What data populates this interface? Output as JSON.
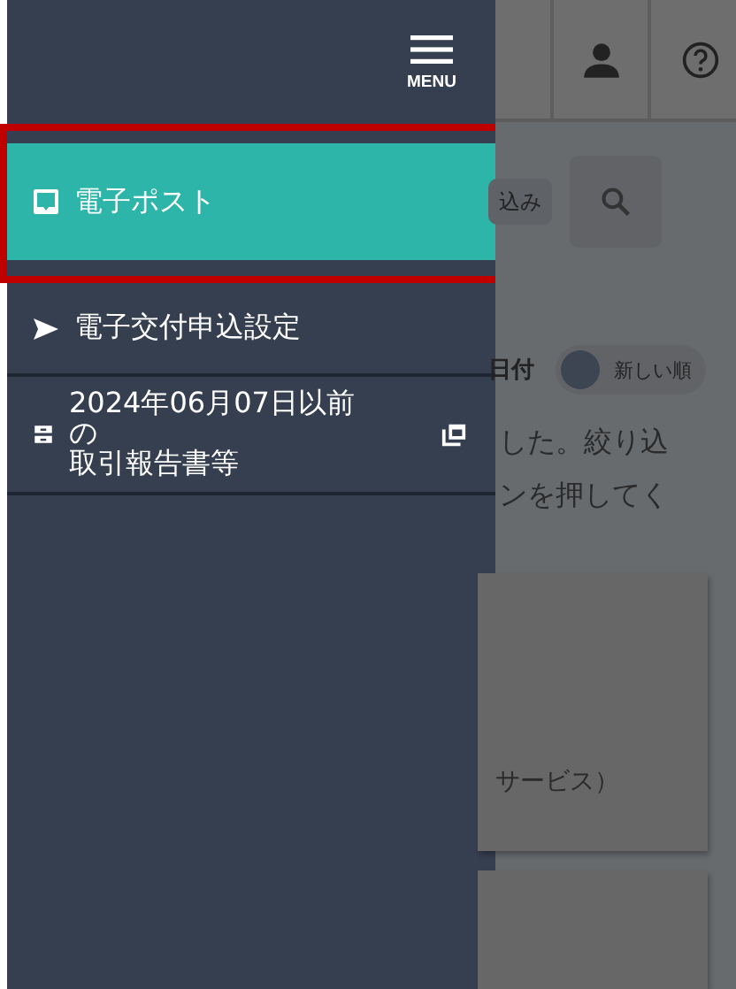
{
  "menu_button": {
    "label": "MENU"
  },
  "drawer_items": [
    {
      "label_lines": [
        "電子ポスト"
      ],
      "kind": "inbox",
      "selected": true,
      "highlighted": true,
      "external": false
    },
    {
      "label_lines": [
        "電子交付申込設定"
      ],
      "kind": "send",
      "selected": false,
      "highlighted": false,
      "external": false
    },
    {
      "label_lines": [
        "2024年06月07日以前の",
        "取引報告書等"
      ],
      "kind": "archive",
      "selected": false,
      "highlighted": false,
      "external": true
    }
  ],
  "background": {
    "filter_button": "込み",
    "sort_label": "日付",
    "sort_toggle": {
      "label": "新しい順",
      "on": false
    },
    "message_lines": [
      "した。絞り込",
      "ンを押してく"
    ],
    "card_text": "サービス）"
  }
}
